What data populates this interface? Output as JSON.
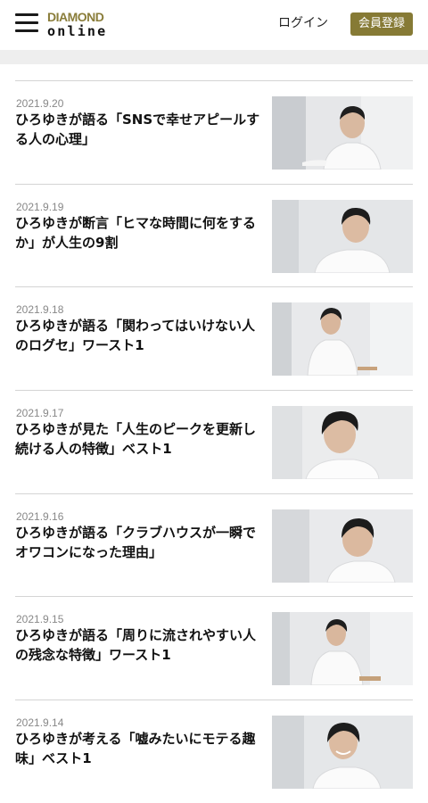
{
  "header": {
    "menu_icon": "hamburger-menu-icon",
    "logo_top": "DIAMOND",
    "logo_bottom": "online",
    "login_label": "ログイン",
    "register_label": "会員登録",
    "colors": {
      "brand_gold": "#867a35",
      "logo_gold": "#8a7d3a"
    }
  },
  "articles": [
    {
      "date": "2021.9.20",
      "title": "ひろゆきが語る「SNSで幸せアピールする人の心理」"
    },
    {
      "date": "2021.9.19",
      "title": "ひろゆきが断言「ヒマな時間に何をするか」が人生の9割"
    },
    {
      "date": "2021.9.18",
      "title": "ひろゆきが語る「関わってはいけない人のログセ」ワースト1"
    },
    {
      "date": "2021.9.17",
      "title": "ひろゆきが見た「人生のピークを更新し続ける人の特徴」ベスト1"
    },
    {
      "date": "2021.9.16",
      "title": "ひろゆきが語る「クラブハウスが一瞬でオワコンになった理由」"
    },
    {
      "date": "2021.9.15",
      "title": "ひろゆきが語る「周りに流されやすい人の残念な特徴」ワースト1"
    },
    {
      "date": "2021.9.14",
      "title": "ひろゆきが考える「嘘みたいにモテる趣味」ベスト1"
    }
  ]
}
